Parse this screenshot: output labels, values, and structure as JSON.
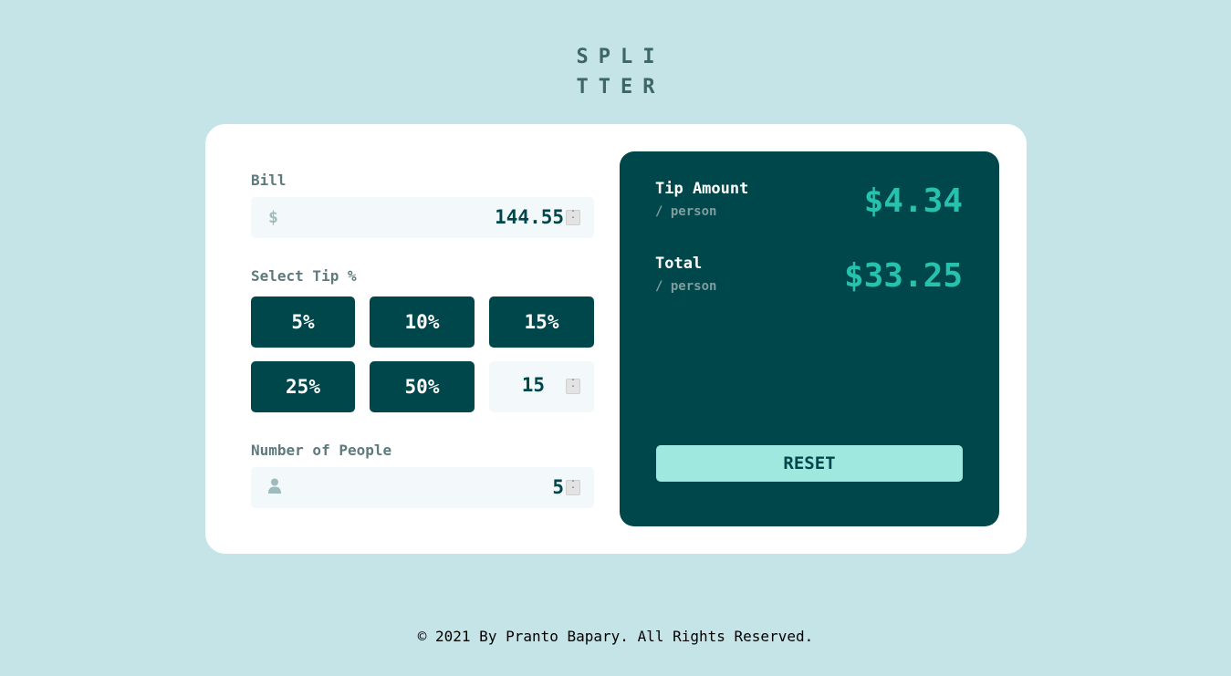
{
  "logo": {
    "line1": "SPLI",
    "line2": "TTER"
  },
  "bill": {
    "label": "Bill",
    "currency_icon": "$",
    "value": "144.55"
  },
  "tip": {
    "label": "Select Tip %",
    "options": [
      "5%",
      "10%",
      "15%",
      "25%",
      "50%"
    ],
    "custom_value": "15"
  },
  "people": {
    "label": "Number of People",
    "icon": "person-icon",
    "value": "5"
  },
  "results": {
    "tip_title": "Tip Amount",
    "tip_sub": "/ person",
    "tip_amount": "$4.34",
    "total_title": "Total",
    "total_sub": "/ person",
    "total_amount": "$33.25",
    "reset_label": "RESET"
  },
  "footer": {
    "text": "© 2021 By Pranto Bapary. All Rights Reserved."
  },
  "colors": {
    "background": "#c5e4e7",
    "dark_cyan": "#00474b",
    "accent": "#26c2ae",
    "reset_bg": "#9fe8df"
  }
}
